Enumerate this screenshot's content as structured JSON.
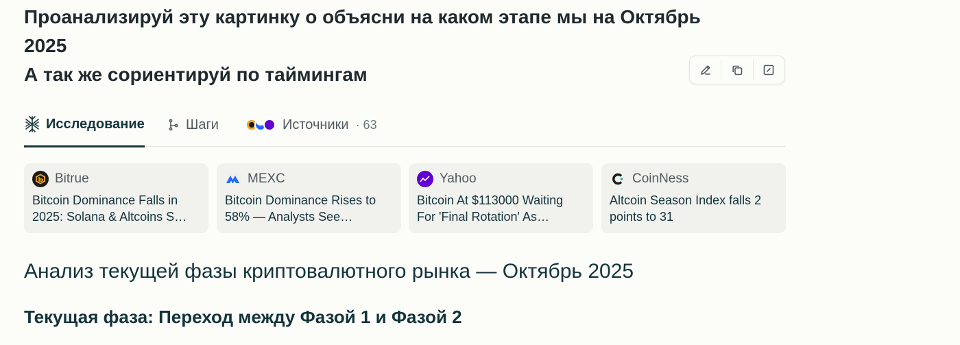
{
  "question": {
    "line1": "Проанализируй эту картинку о объясни на каком этапе мы на Октябрь",
    "line2": "2025",
    "line3": "А так же сориентируй по таймингам"
  },
  "tabs": {
    "research": "Исследование",
    "steps": "Шаги",
    "sources": "Источники",
    "sources_count": "· 63"
  },
  "cards": [
    {
      "source": "Bitrue",
      "title": "Bitcoin Dominance Falls in 2025: Solana & Altcoins S…",
      "logo_color": "#f5a623",
      "logo_bg": "#1a1a1a"
    },
    {
      "source": "MEXC",
      "title": "Bitcoin Dominance Rises to 58% — Analysts See…",
      "logo_color": "#1f6bff",
      "logo_bg": "transparent"
    },
    {
      "source": "Yahoo",
      "title": "Bitcoin At $113000 Waiting For 'Final Rotation' As…",
      "logo_color": "#ffffff",
      "logo_bg": "#6001d2"
    },
    {
      "source": "CoinNess",
      "title": "Altcoin Season Index falls 2 points to 31",
      "logo_color": "#1a1a1a",
      "logo_bg": "transparent"
    }
  ],
  "answer": {
    "heading": "Анализ текущей фазы криптовалютного рынка — Октябрь 2025",
    "subheading": "Текущая фаза: Переход между Фазой 1 и Фазой 2"
  },
  "colors": {
    "accent": "#13343b",
    "background": "#fcfcf9",
    "card_bg": "#f1f1ee"
  }
}
